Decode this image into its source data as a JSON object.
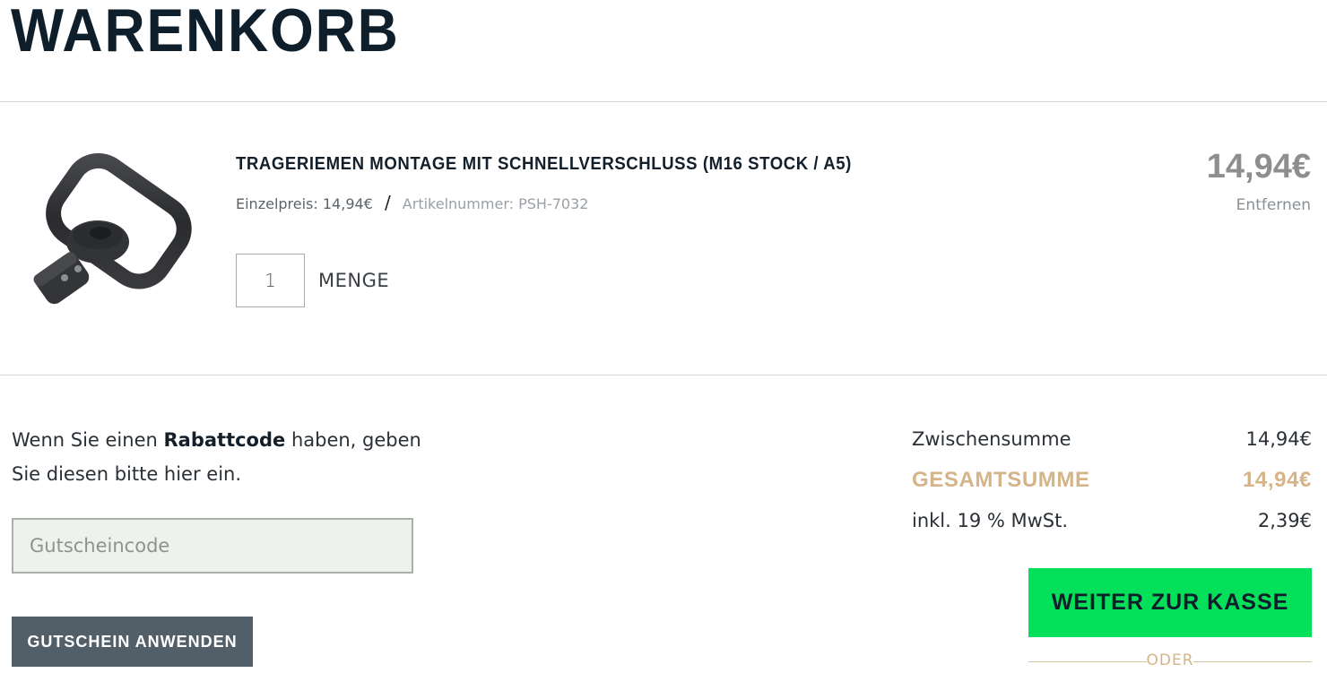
{
  "page": {
    "title": "WARENKORB"
  },
  "cart_item": {
    "name": "TRAGERIEMEN MONTAGE MIT SCHNELLVERSCHLUSS (M16 STOCK / A5)",
    "unit_price_label": "Einzelpreis:",
    "unit_price": "14,94€",
    "separator": "/",
    "sku_label": "Artikelnummer:",
    "sku": "PSH-7032",
    "quantity": "1",
    "quantity_label": "MENGE",
    "line_total": "14,94€",
    "remove_label": "Entfernen"
  },
  "coupon": {
    "text_before": "Wenn Sie einen ",
    "text_bold": "Rabattcode",
    "text_after": " haben, geben Sie diesen bitte hier ein.",
    "placeholder": "Gutscheincode",
    "button_label": "GUTSCHEIN ANWENDEN"
  },
  "summary": {
    "subtotal_label": "Zwischensumme",
    "subtotal_value": "14,94€",
    "total_label": "GESAMTSUMME",
    "total_value": "14,94€",
    "vat_label": "inkl. 19 % MwSt.",
    "vat_value": "2,39€",
    "checkout_label": "WEITER ZUR KASSE",
    "or_label": "ODER"
  },
  "colors": {
    "accent_green": "#05e05a",
    "accent_gold": "#d4b488",
    "button_slate": "#525f69",
    "text_dark": "#0e1f2b"
  }
}
